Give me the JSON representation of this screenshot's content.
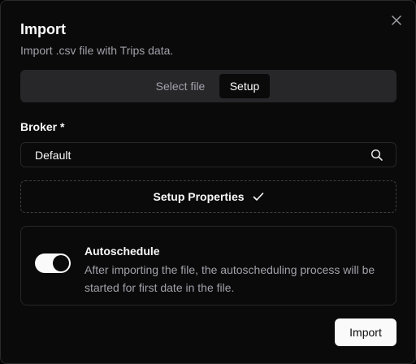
{
  "dialog": {
    "title": "Import",
    "subtitle": "Import .csv file with Trips data.",
    "close_icon": "close-icon"
  },
  "tabs": [
    {
      "label": "Select file",
      "active": false
    },
    {
      "label": "Setup",
      "active": true
    }
  ],
  "broker": {
    "label": "Broker *",
    "value": "Default",
    "icon": "search-icon"
  },
  "setup_properties": {
    "label": "Setup Properties",
    "icon": "check-icon"
  },
  "autoschedule": {
    "title": "Autoschedule",
    "description": "After importing the file, the autoscheduling process will be started for first date in the file.",
    "enabled": true
  },
  "footer": {
    "import_label": "Import"
  },
  "colors": {
    "background": "#0a0a0a",
    "border": "#27272a",
    "text": "#fafafa",
    "muted": "#a1a1aa",
    "tab_track": "#27272a"
  }
}
